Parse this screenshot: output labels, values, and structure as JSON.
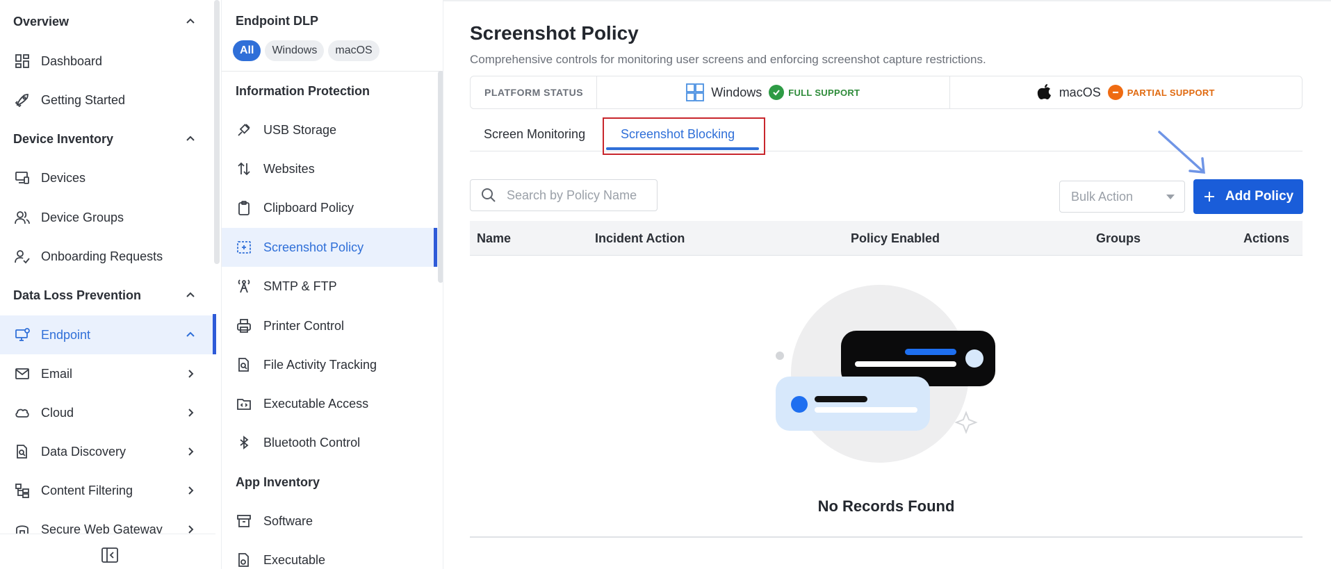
{
  "nav": {
    "sections": [
      {
        "label": "Overview"
      },
      {
        "label": "Device Inventory"
      },
      {
        "label": "Data Loss Prevention"
      }
    ],
    "items": [
      {
        "label": "Dashboard",
        "icon": "grid-icon"
      },
      {
        "label": "Getting Started",
        "icon": "rocket-icon"
      },
      {
        "label": "Devices",
        "icon": "devices-icon"
      },
      {
        "label": "Device Groups",
        "icon": "users-icon"
      },
      {
        "label": "Onboarding Requests",
        "icon": "user-check-icon"
      },
      {
        "label": "Endpoint",
        "icon": "monitor-gear-icon"
      },
      {
        "label": "Email",
        "icon": "mail-icon"
      },
      {
        "label": "Cloud",
        "icon": "cloud-icon"
      },
      {
        "label": "Data Discovery",
        "icon": "file-search-icon"
      },
      {
        "label": "Content Filtering",
        "icon": "filter-tree-icon"
      },
      {
        "label": "Secure Web Gateway",
        "icon": "gateway-icon"
      }
    ]
  },
  "subnav": {
    "title": "Endpoint DLP",
    "chips": [
      "All",
      "Windows",
      "macOS"
    ],
    "groups": [
      "Information Protection",
      "App Inventory"
    ],
    "items": [
      {
        "label": "USB Storage",
        "icon": "usb-icon"
      },
      {
        "label": "Websites",
        "icon": "arrows-updown-icon"
      },
      {
        "label": "Clipboard Policy",
        "icon": "clipboard-icon"
      },
      {
        "label": "Screenshot Policy",
        "icon": "screenshot-icon"
      },
      {
        "label": "SMTP & FTP",
        "icon": "tower-icon"
      },
      {
        "label": "Printer Control",
        "icon": "printer-icon"
      },
      {
        "label": "File Activity Tracking",
        "icon": "file-search-icon"
      },
      {
        "label": "Executable Access",
        "icon": "folder-code-icon"
      },
      {
        "label": "Bluetooth Control",
        "icon": "bluetooth-icon"
      },
      {
        "label": "Software",
        "icon": "archive-icon"
      },
      {
        "label": "Executable",
        "icon": "file-gear-icon"
      }
    ]
  },
  "main": {
    "title": "Screenshot Policy",
    "subtitle": "Comprehensive controls for monitoring user screens and enforcing screenshot capture restrictions.",
    "platform_status": {
      "label": "PLATFORM STATUS",
      "windows": {
        "name": "Windows",
        "badge": "FULL SUPPORT"
      },
      "macos": {
        "name": "macOS",
        "badge": "PARTIAL SUPPORT"
      }
    },
    "tabs": [
      "Screen Monitoring",
      "Screenshot Blocking"
    ],
    "search_placeholder": "Search by Policy Name",
    "bulk_action": "Bulk Action",
    "add_policy": "Add Policy",
    "columns": [
      "Name",
      "Incident Action",
      "Policy Enabled",
      "Groups",
      "Actions"
    ],
    "empty_text": "No Records Found"
  },
  "colors": {
    "accent": "#2f6fd8",
    "button": "#1a5dd9",
    "full": "#2e9b45",
    "partial": "#ef6b12"
  }
}
